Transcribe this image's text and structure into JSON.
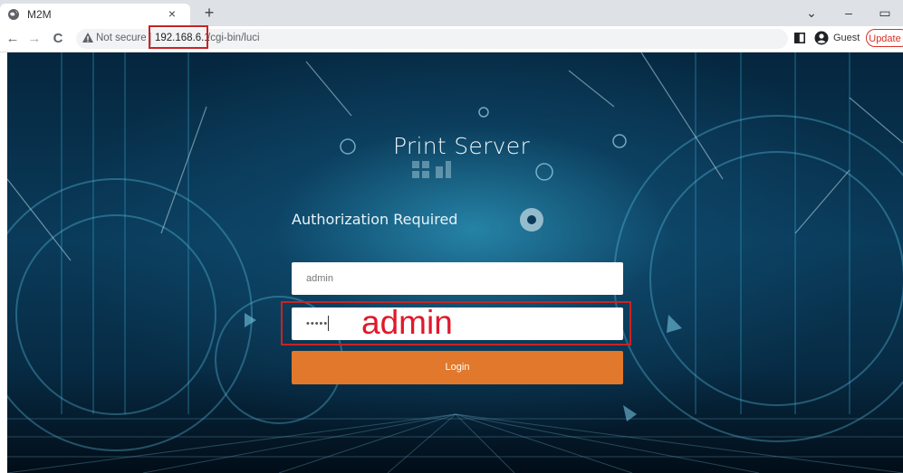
{
  "browser": {
    "tab_title": "M2M",
    "close_glyph": "×",
    "newtab_glyph": "+",
    "security_label": "Not secure",
    "url_host": "192.168.6.1",
    "url_path": "/cgi-bin/luci",
    "profile_label": "Guest",
    "update_label": "Update",
    "win_minimize": "–",
    "win_restore": "▭",
    "tab_search": "⌄",
    "back_glyph": "←",
    "forward_glyph": "→",
    "reload_glyph": "C"
  },
  "page": {
    "title": "Print Server",
    "subtitle": "Authorization Required",
    "username_value": "admin",
    "password_value": "•••••",
    "annotation": "admin",
    "login_label": "Login"
  },
  "colors": {
    "login_button": "#e1782b",
    "highlight": "#cc2222",
    "annotation": "#e0192a"
  }
}
